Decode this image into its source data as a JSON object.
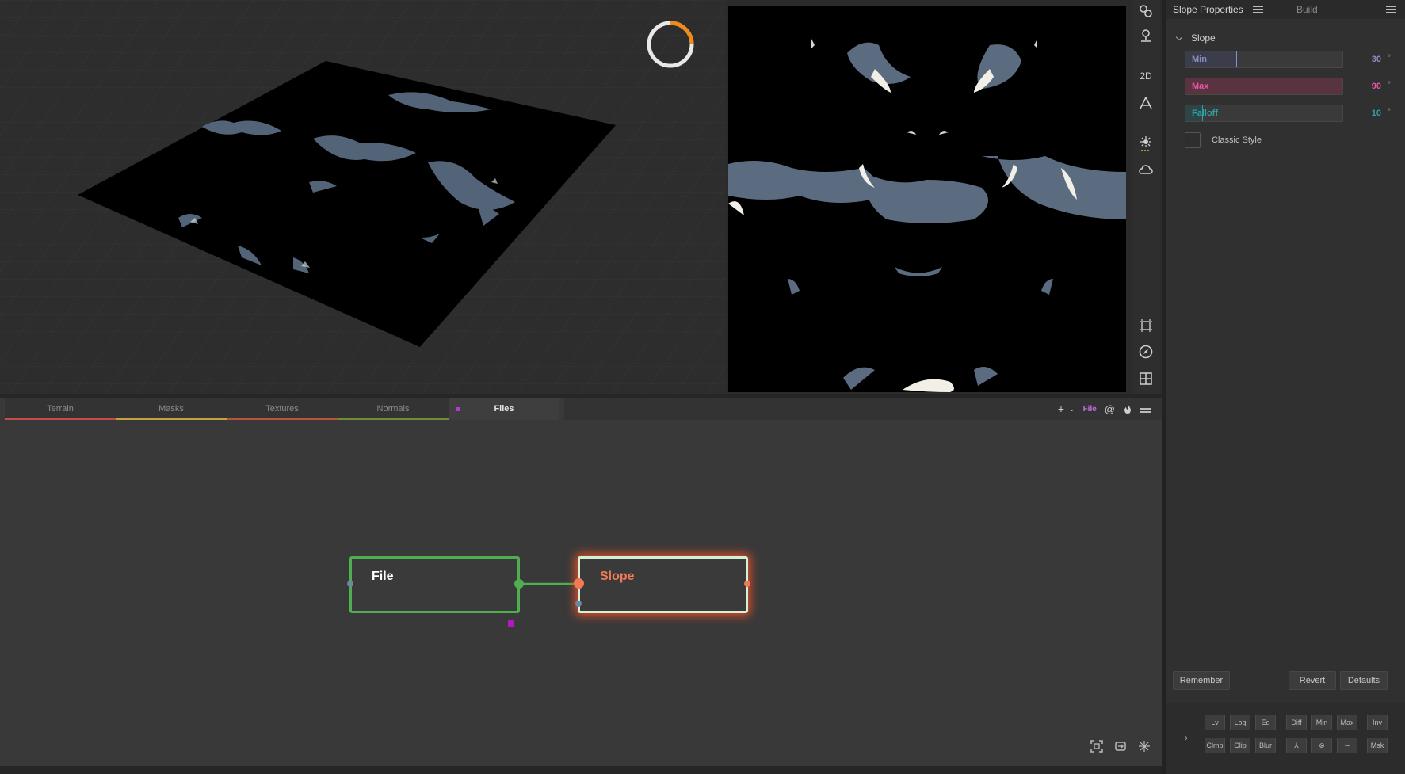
{
  "viewport": {
    "progress_ring": {
      "progress": 0.25,
      "accent": "#f28a1a"
    }
  },
  "toolbar": {
    "items": [
      {
        "name": "nodes-link-icon"
      },
      {
        "name": "pin-icon"
      },
      {
        "name": "view-2d",
        "label": "2D"
      },
      {
        "name": "perspective-icon"
      },
      {
        "name": "sun-icon"
      },
      {
        "name": "cloud-icon"
      },
      {
        "name": "frame-icon"
      },
      {
        "name": "compass-icon"
      },
      {
        "name": "grid-icon"
      }
    ]
  },
  "properties": {
    "title": "Slope Properties",
    "build_tab": "Build",
    "section": "Slope",
    "params": [
      {
        "label": "Min",
        "value": "30",
        "unit": "°",
        "fraction": 0.33,
        "color": "#8f8ec8",
        "fill": "#3c3d4a"
      },
      {
        "label": "Max",
        "value": "90",
        "unit": "°",
        "fraction": 1.0,
        "color": "#e058a8",
        "fill": "#5a3340"
      },
      {
        "label": "Falloff",
        "value": "10",
        "unit": "°",
        "fraction": 0.11,
        "color": "#2aa3a6",
        "fill": "#2f4545"
      }
    ],
    "classic_style": {
      "label": "Classic Style",
      "checked": false
    },
    "buttons": {
      "remember": "Remember",
      "revert": "Revert",
      "defaults": "Defaults"
    },
    "quick": {
      "row1": [
        "Lv",
        "Log",
        "Eq",
        "Diff",
        "Min",
        "Max",
        "Inv"
      ],
      "row2": [
        "Clmp",
        "Clip",
        "Blur",
        "⅄",
        "⊗",
        "∼",
        "Msk"
      ]
    }
  },
  "graph": {
    "tabs": [
      {
        "label": "Terrain",
        "color": "#c44b4b"
      },
      {
        "label": "Masks",
        "color": "#c3a43c"
      },
      {
        "label": "Textures",
        "color": "#b5553b"
      },
      {
        "label": "Normals",
        "color": "#6f8f35"
      },
      {
        "label": "Files",
        "color": "#b23ad2",
        "active": true
      }
    ],
    "toolbar_file": "File",
    "nodes": [
      {
        "title": "File",
        "border": "#4fae4f",
        "title_color": "#ffffff"
      },
      {
        "title": "Slope",
        "border": "#d6f0d6",
        "title_color": "#f07a55",
        "glow": "#e0502a"
      }
    ]
  }
}
